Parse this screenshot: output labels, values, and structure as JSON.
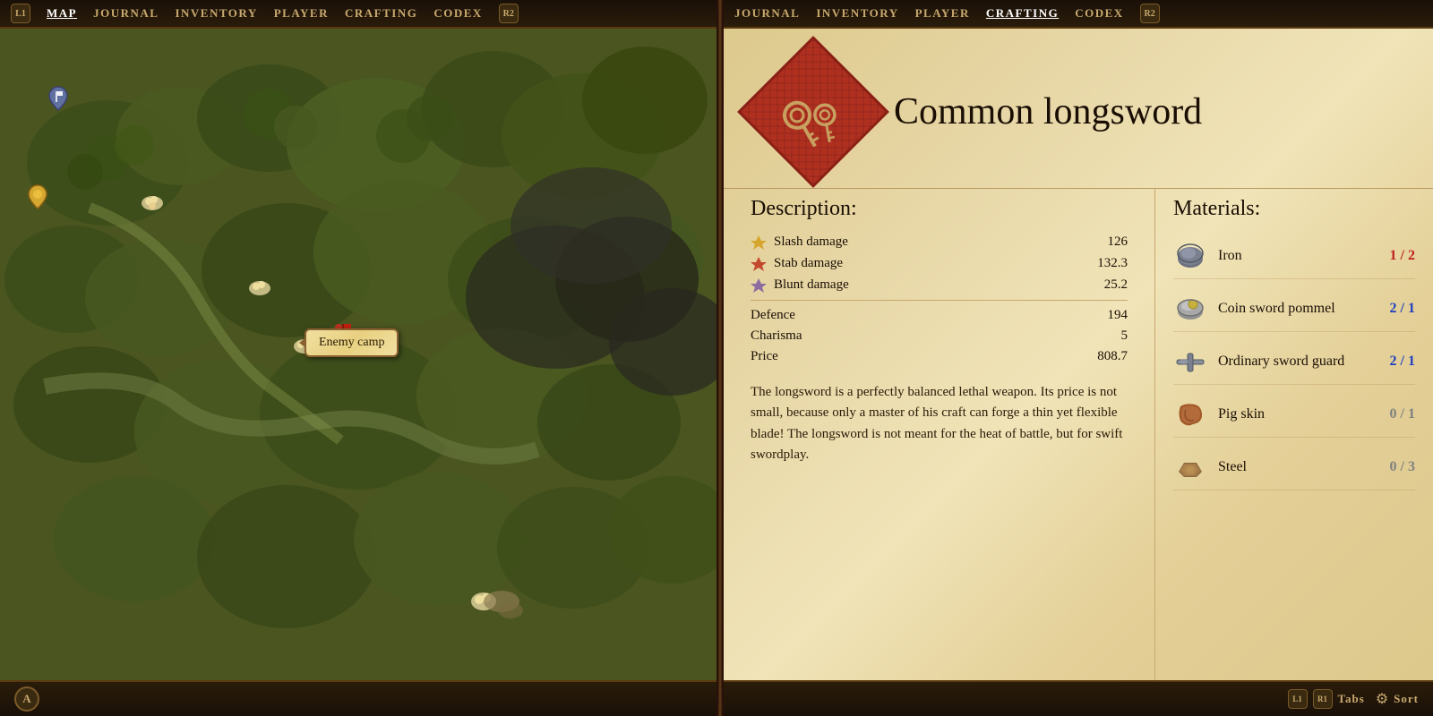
{
  "leftNav": {
    "l1": "L1",
    "map": "MAP",
    "journal": "JOURNAL",
    "inventory": "INVENTORY",
    "player": "PLAYER",
    "crafting": "CRAFTING",
    "codex": "CODEX",
    "r2": "R2"
  },
  "rightNav": {
    "journal": "JOURNAL",
    "inventory": "INVENTORY",
    "player": "PLAYER",
    "crafting": "CRAFTING",
    "codex": "CODEX",
    "r2": "R2"
  },
  "map": {
    "enemyCampLabel": "Enemy camp",
    "aButton": "A"
  },
  "item": {
    "title": "Common longsword",
    "icon": "sword-keys"
  },
  "description": {
    "sectionTitle": "Description:",
    "stats": [
      {
        "name": "Slash damage",
        "value": "126",
        "icon": "slash"
      },
      {
        "name": "Stab damage",
        "value": "132.3",
        "icon": "stab"
      },
      {
        "name": "Blunt damage",
        "value": "25.2",
        "icon": "blunt"
      },
      {
        "name": "Defence",
        "value": "194",
        "icon": null
      },
      {
        "name": "Charisma",
        "value": "5",
        "icon": null
      },
      {
        "name": "Price",
        "value": "808.7",
        "icon": null
      }
    ],
    "text": "The longsword is a perfectly balanced lethal weapon. Its price is not small, because only a master of his craft can forge a thin yet flexible blade! The longsword is not meant for the heat of battle, but for swift swordplay."
  },
  "materials": {
    "sectionTitle": "Materials:",
    "items": [
      {
        "name": "Iron",
        "have": 1,
        "need": 2,
        "status": "partial"
      },
      {
        "name": "Coin sword pommel",
        "have": 2,
        "need": 1,
        "status": "enough"
      },
      {
        "name": "Ordinary sword guard",
        "have": 2,
        "need": 1,
        "status": "enough"
      },
      {
        "name": "Pig skin",
        "have": 0,
        "need": 1,
        "status": "none"
      },
      {
        "name": "Steel",
        "have": 0,
        "need": 3,
        "status": "none"
      }
    ]
  },
  "footer": {
    "l1": "L1",
    "r1": "R1",
    "tabs": "Tabs",
    "sort": "Sort"
  }
}
